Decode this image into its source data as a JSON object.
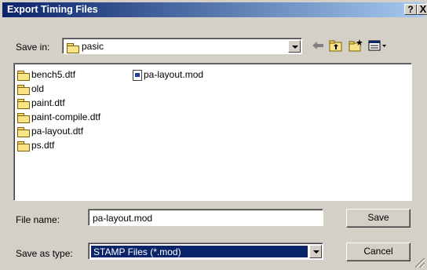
{
  "window": {
    "title": "Export Timing Files",
    "help_label": "?",
    "close_label": "X"
  },
  "save_in": {
    "label": "Save in:",
    "value": "pasic",
    "icon": "folder-open-icon"
  },
  "toolbar": {
    "back_icon": "back-arrow-icon",
    "up_icon": "up-folder-icon",
    "new_icon": "new-folder-icon",
    "view_icon": "view-menu-icon"
  },
  "files": {
    "col1": [
      {
        "name": "bench5.dtf",
        "icon": "folder-icon"
      },
      {
        "name": "old",
        "icon": "folder-icon"
      },
      {
        "name": "paint.dtf",
        "icon": "folder-icon"
      },
      {
        "name": "paint-compile.dtf",
        "icon": "folder-icon"
      },
      {
        "name": "pa-layout.dtf",
        "icon": "folder-icon"
      },
      {
        "name": "ps.dtf",
        "icon": "folder-icon"
      }
    ],
    "col2": [
      {
        "name": "pa-layout.mod",
        "icon": "mod-file-icon"
      }
    ]
  },
  "file_name": {
    "label": "File name:",
    "value": "pa-layout.mod"
  },
  "save_as_type": {
    "label": "Save as type:",
    "value": "STAMP Files (*.mod)"
  },
  "buttons": {
    "save": "Save",
    "cancel": "Cancel"
  }
}
